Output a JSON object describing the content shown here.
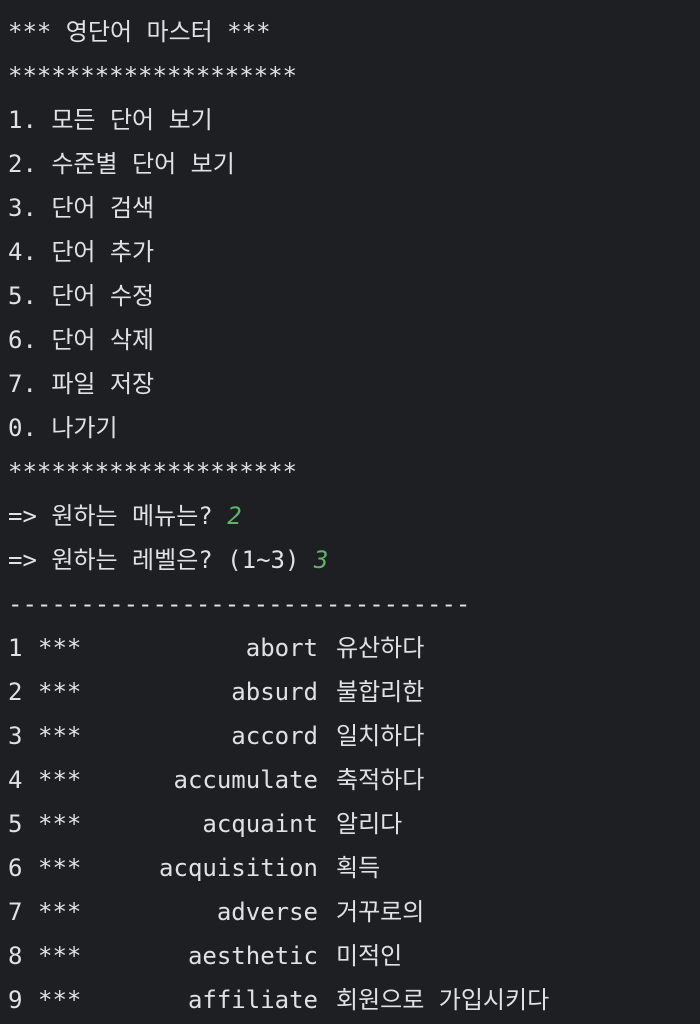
{
  "title_line": "*** 영단어 마스터 ***",
  "separator_stars": "********************",
  "menu_items": [
    "1. 모든 단어 보기",
    "2. 수준별 단어 보기",
    "3. 단어 검색",
    "4. 단어 추가",
    "5. 단어 수정",
    "6. 단어 삭제",
    "7. 파일 저장",
    "0. 나가기"
  ],
  "prompts": [
    {
      "label": "=> 원하는 메뉴는? ",
      "value": "2"
    },
    {
      "label": "=> 원하는 레벨은? (1~3) ",
      "value": "3"
    }
  ],
  "separator_dashes": "--------------------------------",
  "words": [
    {
      "num": "1",
      "level": "***",
      "en": "abort",
      "ko": "유산하다"
    },
    {
      "num": "2",
      "level": "***",
      "en": "absurd",
      "ko": "불합리한"
    },
    {
      "num": "3",
      "level": "***",
      "en": "accord",
      "ko": "일치하다"
    },
    {
      "num": "4",
      "level": "***",
      "en": "accumulate",
      "ko": "축적하다"
    },
    {
      "num": "5",
      "level": "***",
      "en": "acquaint",
      "ko": "알리다"
    },
    {
      "num": "6",
      "level": "***",
      "en": "acquisition",
      "ko": "획득"
    },
    {
      "num": "7",
      "level": "***",
      "en": "adverse",
      "ko": "거꾸로의"
    },
    {
      "num": "8",
      "level": "***",
      "en": "aesthetic",
      "ko": "미적인"
    },
    {
      "num": "9",
      "level": "***",
      "en": "affiliate",
      "ko": "회원으로 가입시키다"
    }
  ],
  "colors": {
    "background": "#1e1f22",
    "text": "#dfe1e5",
    "input": "#5fb36b"
  }
}
